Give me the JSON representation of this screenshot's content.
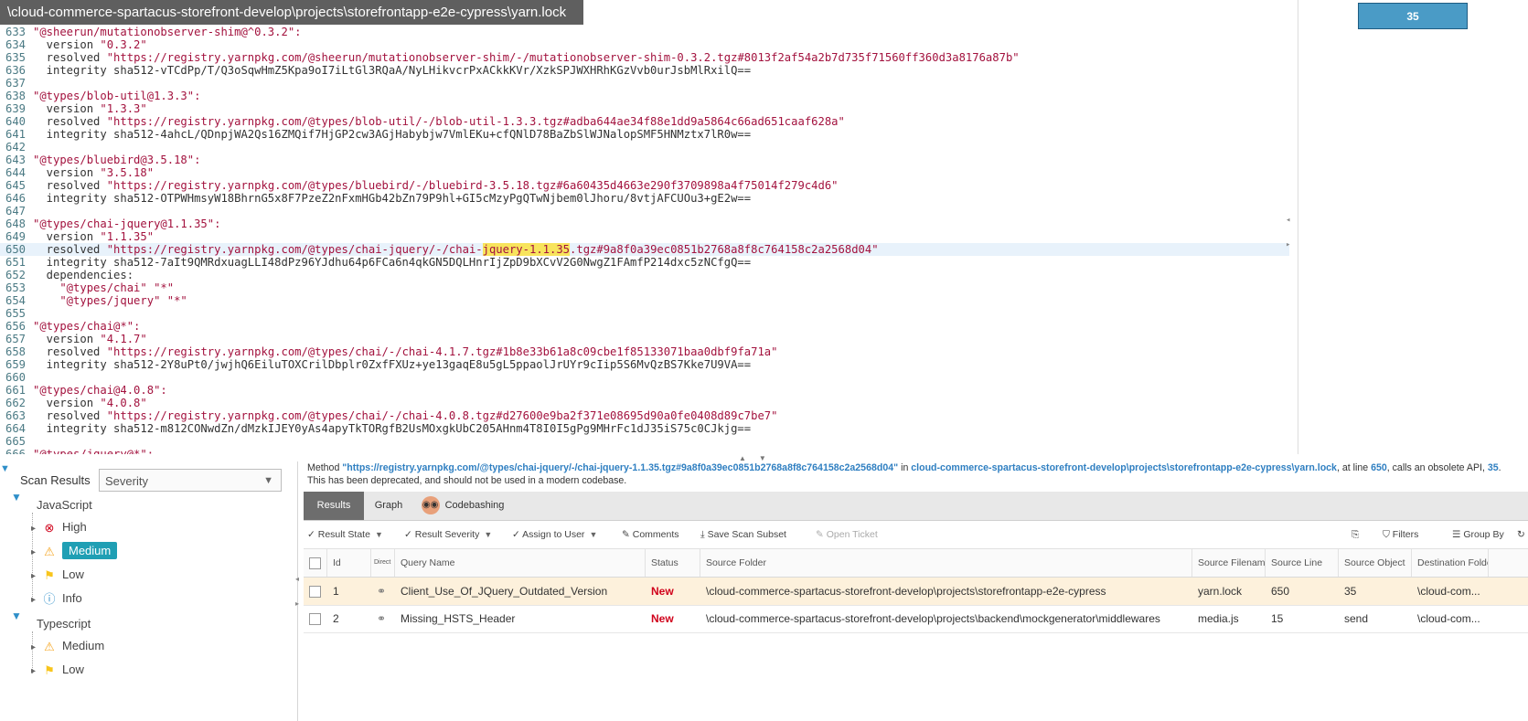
{
  "editor": {
    "file_path": "\\cloud-commerce-spartacus-storefront-develop\\projects\\storefrontapp-e2e-cypress\\yarn.lock",
    "minimap_value": "35",
    "lines": [
      {
        "n": "633",
        "segs": [
          {
            "t": "\"@sheerun/mutationobserver-shim@^0.3.2\":",
            "c": "s"
          }
        ]
      },
      {
        "n": "634",
        "segs": [
          {
            "t": "  version ",
            "c": ""
          },
          {
            "t": "\"0.3.2\"",
            "c": "s"
          }
        ]
      },
      {
        "n": "635",
        "segs": [
          {
            "t": "  resolved ",
            "c": ""
          },
          {
            "t": "\"https://registry.yarnpkg.com/@sheerun/mutationobserver-shim/-/mutationobserver-shim-0.3.2.tgz#8013f2af54a2b7d735f71560ff360d3a8176a87b\"",
            "c": "s"
          }
        ]
      },
      {
        "n": "636",
        "segs": [
          {
            "t": "  integrity sha512-vTCdPp/T/Q3oSqwHmZ5Kpa9oI7iLtGl3RQaA/NyLHikvcrPxACkkKVr/XzkSPJWXHRhKGzVvb0urJsbMlRxilQ==",
            "c": ""
          }
        ]
      },
      {
        "n": "637",
        "segs": []
      },
      {
        "n": "638",
        "segs": [
          {
            "t": "\"@types/blob-util@1.3.3\":",
            "c": "s"
          }
        ]
      },
      {
        "n": "639",
        "segs": [
          {
            "t": "  version ",
            "c": ""
          },
          {
            "t": "\"1.3.3\"",
            "c": "s"
          }
        ]
      },
      {
        "n": "640",
        "segs": [
          {
            "t": "  resolved ",
            "c": ""
          },
          {
            "t": "\"https://registry.yarnpkg.com/@types/blob-util/-/blob-util-1.3.3.tgz#adba644ae34f88e1dd9a5864c66ad651caaf628a\"",
            "c": "s"
          }
        ]
      },
      {
        "n": "641",
        "segs": [
          {
            "t": "  integrity sha512-4ahcL/QDnpjWA2Qs16ZMQif7HjGP2cw3AGjHabybjw7VmlEKu+cfQNlD78BaZbSlWJNalopSMF5HNMztx7lR0w==",
            "c": ""
          }
        ]
      },
      {
        "n": "642",
        "segs": []
      },
      {
        "n": "643",
        "segs": [
          {
            "t": "\"@types/bluebird@3.5.18\":",
            "c": "s"
          }
        ]
      },
      {
        "n": "644",
        "segs": [
          {
            "t": "  version ",
            "c": ""
          },
          {
            "t": "\"3.5.18\"",
            "c": "s"
          }
        ]
      },
      {
        "n": "645",
        "segs": [
          {
            "t": "  resolved ",
            "c": ""
          },
          {
            "t": "\"https://registry.yarnpkg.com/@types/bluebird/-/bluebird-3.5.18.tgz#6a60435d4663e290f3709898a4f75014f279c4d6\"",
            "c": "s"
          }
        ]
      },
      {
        "n": "646",
        "segs": [
          {
            "t": "  integrity sha512-OTPWHmsyW18BhrnG5x8F7PzeZ2nFxmHGb42bZn79P9hl+GI5cMzyPgQTwNjbem0lJhoru/8vtjAFCUOu3+gE2w==",
            "c": ""
          }
        ]
      },
      {
        "n": "647",
        "segs": []
      },
      {
        "n": "648",
        "segs": [
          {
            "t": "\"@types/chai-jquery@1.1.35\":",
            "c": "s"
          }
        ]
      },
      {
        "n": "649",
        "segs": [
          {
            "t": "  version ",
            "c": ""
          },
          {
            "t": "\"1.1.35\"",
            "c": "s"
          }
        ]
      },
      {
        "n": "650",
        "hl": true,
        "segs": [
          {
            "t": "  resolved ",
            "c": ""
          },
          {
            "t": "\"https://registry.yarnpkg.com/@types/chai-jquery/-/chai-",
            "c": "s"
          },
          {
            "t": "jquery-1.1.35",
            "c": "s mark"
          },
          {
            "t": ".tgz#9a8f0a39ec0851b2768a8f8c764158c2a2568d04\"",
            "c": "s"
          }
        ]
      },
      {
        "n": "651",
        "segs": [
          {
            "t": "  integrity sha512-7aIt9QMRdxuagLLI48dPz96YJdhu64p6FCa6n4qkGN5DQLHnrIjZpD9bXCvV2G0NwgZ1FAmfP214dxc5zNCfgQ==",
            "c": ""
          }
        ]
      },
      {
        "n": "652",
        "segs": [
          {
            "t": "  dependencies:",
            "c": ""
          }
        ]
      },
      {
        "n": "653",
        "segs": [
          {
            "t": "    \"@types/chai\" \"*\"",
            "c": "s"
          }
        ]
      },
      {
        "n": "654",
        "segs": [
          {
            "t": "    \"@types/jquery\" \"*\"",
            "c": "s"
          }
        ]
      },
      {
        "n": "655",
        "segs": []
      },
      {
        "n": "656",
        "segs": [
          {
            "t": "\"@types/chai@*\":",
            "c": "s"
          }
        ]
      },
      {
        "n": "657",
        "segs": [
          {
            "t": "  version ",
            "c": ""
          },
          {
            "t": "\"4.1.7\"",
            "c": "s"
          }
        ]
      },
      {
        "n": "658",
        "segs": [
          {
            "t": "  resolved ",
            "c": ""
          },
          {
            "t": "\"https://registry.yarnpkg.com/@types/chai/-/chai-4.1.7.tgz#1b8e33b61a8c09cbe1f85133071baa0dbf9fa71a\"",
            "c": "s"
          }
        ]
      },
      {
        "n": "659",
        "segs": [
          {
            "t": "  integrity sha512-2Y8uPt0/jwjhQ6EiluTOXCrilDbplr0ZxfFXUz+ye13gaqE8u5gL5ppaolJrUYr9cIip5S6MvQzBS7Kke7U9VA==",
            "c": ""
          }
        ]
      },
      {
        "n": "660",
        "segs": []
      },
      {
        "n": "661",
        "segs": [
          {
            "t": "\"@types/chai@4.0.8\":",
            "c": "s"
          }
        ]
      },
      {
        "n": "662",
        "segs": [
          {
            "t": "  version ",
            "c": ""
          },
          {
            "t": "\"4.0.8\"",
            "c": "s"
          }
        ]
      },
      {
        "n": "663",
        "segs": [
          {
            "t": "  resolved ",
            "c": ""
          },
          {
            "t": "\"https://registry.yarnpkg.com/@types/chai/-/chai-4.0.8.tgz#d27600e9ba2f371e08695d90a0fe0408d89c7be7\"",
            "c": "s"
          }
        ]
      },
      {
        "n": "664",
        "segs": [
          {
            "t": "  integrity sha512-m812CONwdZn/dMzkIJEY0yAs4apyTkTORgfB2UsMOxgkUbC205AHnm4T8I0I5gPg9MHrFc1dJ35iS75c0CJkjg==",
            "c": ""
          }
        ]
      },
      {
        "n": "665",
        "segs": []
      },
      {
        "n": "666",
        "segs": [
          {
            "t": "\"@types/jquery@*\":",
            "c": "s"
          }
        ]
      }
    ]
  },
  "left_panel": {
    "scan_results_label": "Scan Results",
    "severity_value": "Severity",
    "tree": [
      {
        "group": "JavaScript",
        "items": [
          {
            "label": "High",
            "icon": "high-severity-icon",
            "glyph": "⊗",
            "color": "#d0021b"
          },
          {
            "label": "Medium",
            "icon": "medium-severity-icon",
            "glyph": "⚠",
            "color": "#f5a623",
            "selected": true
          },
          {
            "label": "Low",
            "icon": "low-severity-icon",
            "glyph": "⚑",
            "color": "#f8c51c"
          },
          {
            "label": "Info",
            "icon": "info-icon",
            "glyph": "ⓘ",
            "color": "#2f8fc9"
          }
        ]
      },
      {
        "group": "Typescript",
        "items": [
          {
            "label": "Medium",
            "icon": "medium-severity-icon",
            "glyph": "⚠",
            "color": "#f5a623"
          },
          {
            "label": "Low",
            "icon": "low-severity-icon",
            "glyph": "⚑",
            "color": "#f8c51c"
          }
        ]
      }
    ]
  },
  "description": {
    "prefix": "Method ",
    "method": "\"https://registry.yarnpkg.com/@types/chai-jquery/-/chai-jquery-1.1.35.tgz#9a8f0a39ec0851b2768a8f8c764158c2a2568d04\"",
    "in": " in ",
    "file": "cloud-commerce-spartacus-storefront-develop\\projects\\storefrontapp-e2e-cypress\\yarn.lock",
    "at_line": ", at line ",
    "line": "650",
    "calls": ", calls an obsolete API, ",
    "api": "35",
    "suffix": ". This has been deprecated, and should not be used in a modern codebase."
  },
  "tabs": {
    "results": "Results",
    "graph": "Graph",
    "codebashing": "Codebashing"
  },
  "toolbar": {
    "result_state": "Result State",
    "result_severity": "Result Severity",
    "assign_to_user": "Assign to User",
    "comments": "Comments",
    "save_scan_subset": "Save Scan Subset",
    "open_ticket": "Open Ticket",
    "filters": "Filters",
    "group_by": "Group By"
  },
  "grid": {
    "headers": {
      "id": "Id",
      "direct": "Direct",
      "query_name": "Query Name",
      "status": "Status",
      "source_folder": "Source Folder",
      "source_filename": "Source Filename",
      "source_line": "Source Line",
      "source_object": "Source Object",
      "destination_folder": "Destination Folde"
    },
    "rows": [
      {
        "id": "1",
        "query_name": "Client_Use_Of_JQuery_Outdated_Version",
        "status": "New",
        "source_folder": "\\cloud-commerce-spartacus-storefront-develop\\projects\\storefrontapp-e2e-cypress",
        "source_filename": "yarn.lock",
        "source_line": "650",
        "source_object": "35",
        "destination_folder": "\\cloud-com..."
      },
      {
        "id": "2",
        "query_name": "Missing_HSTS_Header",
        "status": "New",
        "source_folder": "\\cloud-commerce-spartacus-storefront-develop\\projects\\backend\\mockgenerator\\middlewares",
        "source_filename": "media.js",
        "source_line": "15",
        "source_object": "send",
        "destination_folder": "\\cloud-com..."
      }
    ]
  }
}
